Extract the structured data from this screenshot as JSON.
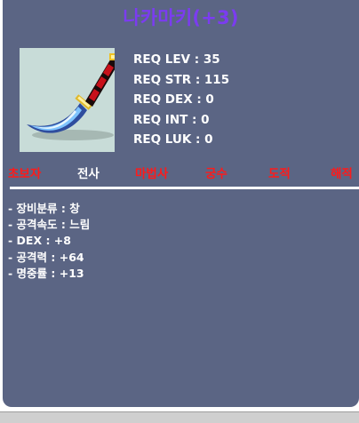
{
  "item": {
    "title": "나카마키(+3)",
    "image_icon": "nakamaki-dagger-icon"
  },
  "requirements": [
    "REQ LEV : 35",
    "REQ STR : 115",
    "REQ DEX : 0",
    "REQ INT : 0",
    "REQ LUK : 0"
  ],
  "jobs": [
    {
      "label": "초보자",
      "status": "disabled"
    },
    {
      "label": "전사",
      "status": "enabled"
    },
    {
      "label": "마법사",
      "status": "disabled"
    },
    {
      "label": "궁수",
      "status": "disabled"
    },
    {
      "label": "도적",
      "status": "disabled"
    },
    {
      "label": "해적",
      "status": "disabled"
    }
  ],
  "stats": [
    "- 장비분류 : 창",
    "- 공격속도 : 느림",
    "- DEX : +8",
    "- 공격력 : +64",
    "- 명중률 : +13"
  ],
  "colors": {
    "panel_bg": "#5b6584",
    "title": "#7b3cf0",
    "disabled_job": "#ff1a1a",
    "enabled_job": "#ffffff",
    "text": "#ffffff"
  }
}
